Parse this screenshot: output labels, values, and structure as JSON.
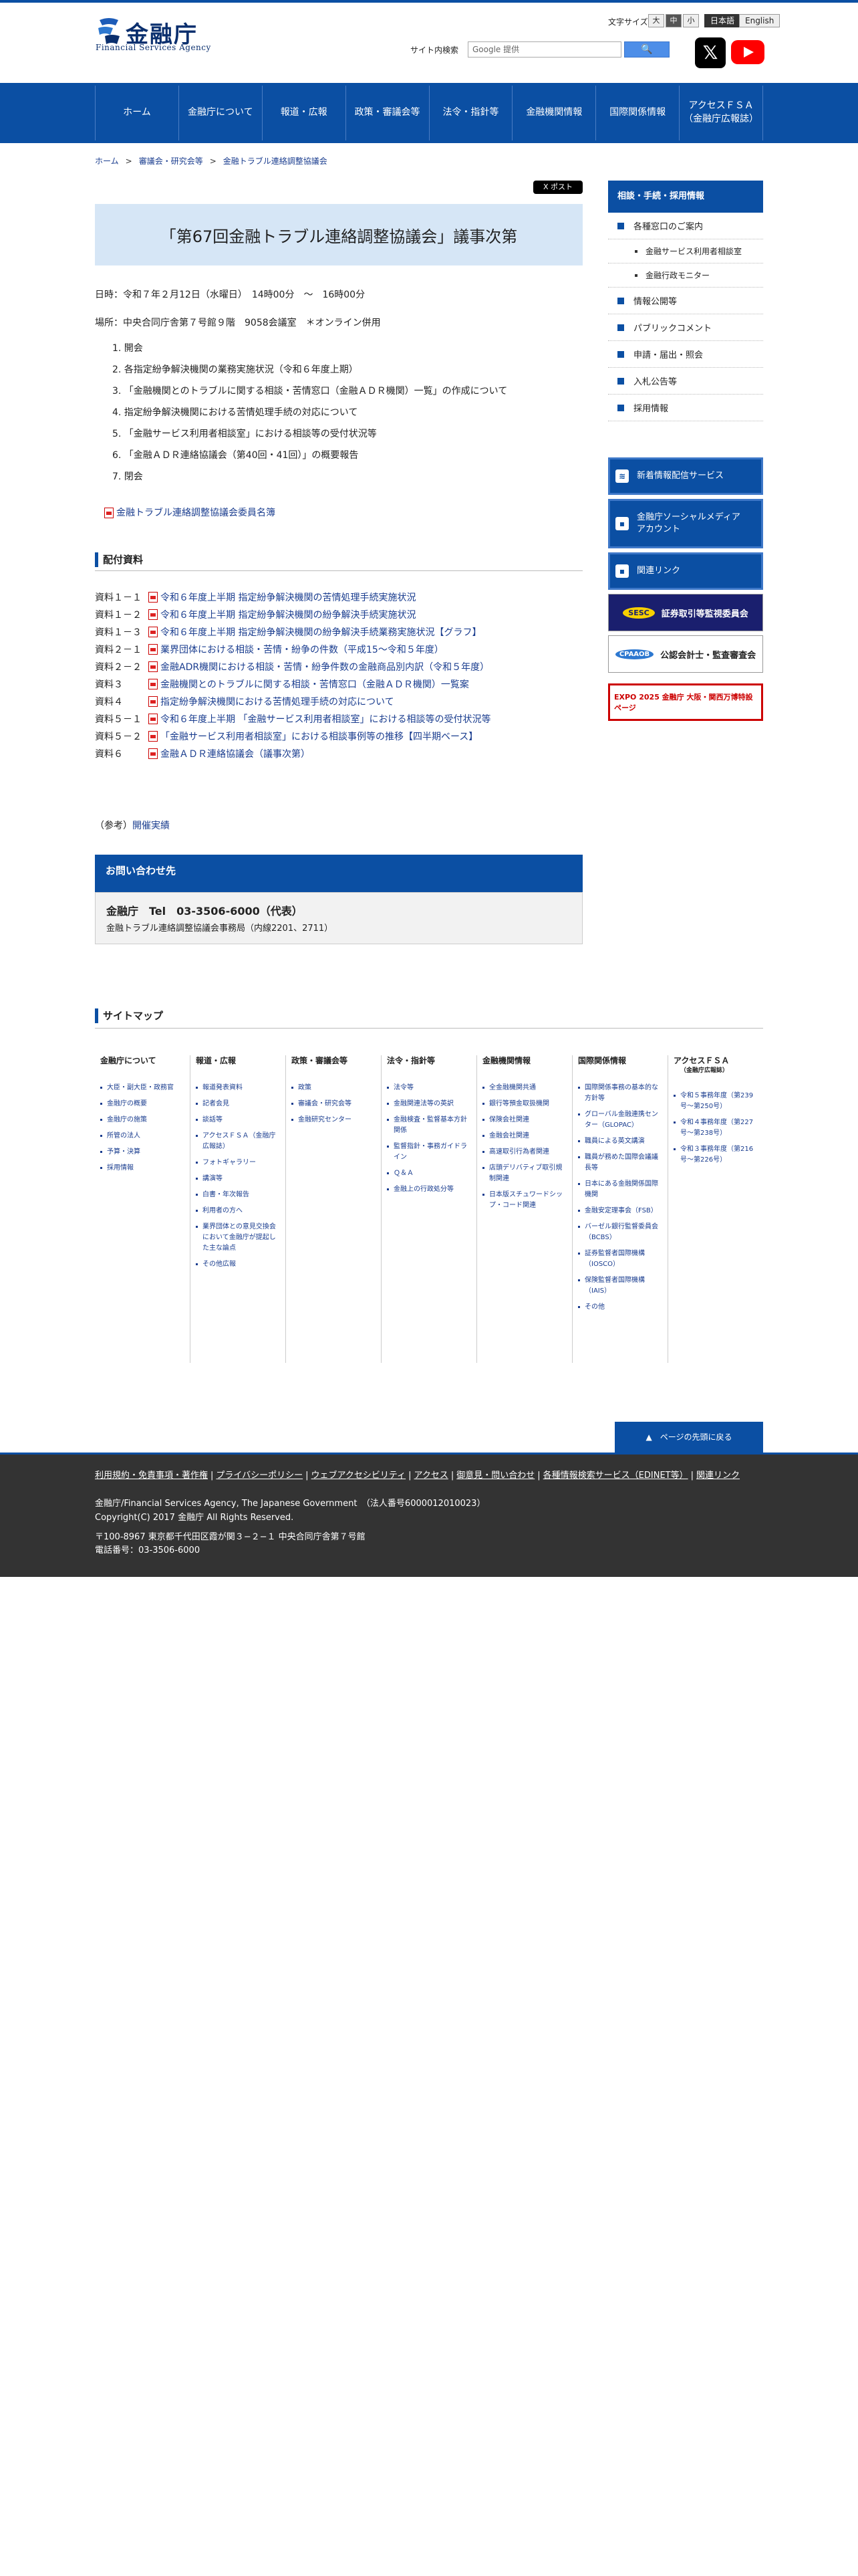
{
  "header": {
    "logo_text": "金融庁",
    "logo_sub": "Financial Services Agency",
    "font_size_label": "文字サイズ",
    "font_sizes": [
      "大",
      "中",
      "小"
    ],
    "lang": [
      "日本語",
      "English"
    ],
    "search_label": "サイト内検索",
    "search_placeholder": "Google 提供",
    "search_button": "🔍",
    "x_icon": "x-icon",
    "youtube_icon": "youtube-icon"
  },
  "nav": [
    "ホーム",
    "金融庁について",
    "報道・広報",
    "政策・審議会等",
    "法令・指針等",
    "金融機関情報",
    "国際関係情報",
    "アクセスＦＳＡ\n（金融庁広報誌）"
  ],
  "breadcrumb": [
    "ホーム",
    "審議会・研究会等",
    "金融トラブル連絡調整協議会"
  ],
  "tweet": "X ポスト",
  "main": {
    "title": "「第67回金融トラブル連絡調整協議会」議事次第",
    "datetime": "日時：令和７年２月12日（水曜日）　14時00分　～　16時00分",
    "place": "場所：中央合同庁舎第７号館９階　9058会議室　＊オンライン併用",
    "agenda": [
      "1. 開会",
      "2. 各指定紛争解決機関の業務実施状況（令和６年度上期）",
      "3. 「金融機関とのトラブルに関する相談・苦情窓口（金融ＡＤＲ機関）一覧」の作成について",
      "4. 指定紛争解決機関における苦情処理手続の対応について",
      "5. 「金融サービス利用者相談室」における相談等の受付状況等",
      "6. 「金融ＡＤＲ連絡協議会（第40回・41回）」の概要報告",
      "7. 閉会"
    ],
    "member_link": "金融トラブル連絡調整協議会委員名簿",
    "materials_heading": "配付資料",
    "materials": [
      {
        "label": "資料１－１",
        "text": "令和６年度上半期 指定紛争解決機関の苦情処理手続実施状況"
      },
      {
        "label": "資料１－２",
        "text": "令和６年度上半期 指定紛争解決機関の紛争解決手続実施状況"
      },
      {
        "label": "資料１－３",
        "text": "令和６年度上半期 指定紛争解決機関の紛争解決手続業務実施状況【グラフ】"
      },
      {
        "label": "資料２－１",
        "text": "業界団体における相談・苦情・紛争の件数（平成15～令和５年度）"
      },
      {
        "label": "資料２－２",
        "text": "金融ADR機関における相談・苦情・紛争件数の金融商品別内訳（令和５年度）"
      },
      {
        "label": "資料３",
        "text": "金融機関とのトラブルに関する相談・苦情窓口（金融ＡＤＲ機関）一覧案"
      },
      {
        "label": "資料４",
        "text": "指定紛争解決機関における苦情処理手続の対応について"
      },
      {
        "label": "資料５－１",
        "text": "令和６年度上半期 「金融サービス利用者相談室」における相談等の受付状況等"
      },
      {
        "label": "資料５－２",
        "text": "「金融サービス利用者相談室」における相談事例等の推移【四半期ベース】"
      },
      {
        "label": "資料６",
        "text": "金融ＡＤＲ連絡協議会（議事次第）"
      }
    ],
    "ref_prefix": "（参考）",
    "ref_link": "開催実績",
    "contact_heading": "お問い合わせ先",
    "contact_tel": "金融庁　Tel　03-3506-6000（代表）",
    "contact_org": "金融トラブル連絡調整協議会事務局（内線2201、2711）"
  },
  "side": {
    "heading": "相談・手続・採用情報",
    "items": [
      {
        "label": "各種窓口のご案内",
        "sub": [
          "金融サービス利用者相談室",
          "金融行政モニター"
        ]
      },
      {
        "label": "情報公開等",
        "sub": []
      },
      {
        "label": "パブリックコメント",
        "sub": []
      },
      {
        "label": "申請・届出・照会",
        "sub": []
      },
      {
        "label": "入札公告等",
        "sub": []
      },
      {
        "label": "採用情報",
        "sub": []
      }
    ],
    "blue_buttons": [
      "新着情報配信サービス",
      "金融庁ソーシャルメディア\nアカウント",
      "関連リンク"
    ],
    "banners": [
      "証券取引等監視委員会",
      "公認会計士・監査審査会",
      "EXPO 2025 金融庁 大阪・関西万博特設ページ"
    ]
  },
  "sitemap": {
    "heading": "サイトマップ",
    "columns": [
      {
        "title": "金融庁について",
        "sub": "",
        "items": [
          "大臣・副大臣・政務官",
          "金融庁の概要",
          "金融庁の施策",
          "所管の法人",
          "予算・決算",
          "採用情報"
        ]
      },
      {
        "title": "報道・広報",
        "sub": "",
        "items": [
          "報道発表資料",
          "記者会見",
          "談話等",
          "アクセスＦＳＡ（金融庁広報誌）",
          "フォトギャラリー",
          "講演等",
          "白書・年次報告",
          "利用者の方へ",
          "業界団体との意見交換会において金融庁が提起した主な論点",
          "その他広報"
        ]
      },
      {
        "title": "政策・審議会等",
        "sub": "",
        "items": [
          "政策",
          "審議会・研究会等",
          "金融研究センター"
        ]
      },
      {
        "title": "法令・指針等",
        "sub": "",
        "items": [
          "法令等",
          "金融関連法等の英訳",
          "金融検査・監督基本方針関係",
          "監督指針・事務ガイドライン",
          "Ｑ＆Ａ",
          "金融上の行政処分等"
        ]
      },
      {
        "title": "金融機関情報",
        "sub": "",
        "items": [
          "全金融機関共通",
          "銀行等預金取扱機関",
          "保険会社関連",
          "金融会社関連",
          "高速取引行為者関連",
          "店頭デリバティブ取引規制関連",
          "日本版スチュワードシップ・コード関連"
        ]
      },
      {
        "title": "国際関係情報",
        "sub": "",
        "items": [
          "国際関係事務の基本的な方針等",
          "グローバル金融連携センター（GLOPAC）",
          "職員による英文講演",
          "職員が務めた国際会議議長等",
          "日本にある金融関係国際機関",
          "金融安定理事会（FSB）",
          "バーゼル銀行監督委員会（BCBS）",
          "証券監督者国際機構（IOSCO）",
          "保険監督者国際機構（IAIS）",
          "その他"
        ]
      },
      {
        "title": "アクセスＦＳＡ",
        "sub": "（金融庁広報誌）",
        "items": [
          "令和５事務年度（第239号〜第250号）",
          "令和４事務年度（第227号〜第238号）",
          "令和３事務年度（第216号〜第226号）"
        ]
      }
    ],
    "to_top": "▲　ページの先頭に戻る"
  },
  "footer": {
    "links": [
      "利用規約・免責事項・著作権",
      "プライバシーポリシー",
      "ウェブアクセシビリティ",
      "アクセス",
      "御意見・問い合わせ",
      "各種情報検索サービス（EDINET等）",
      "関連リンク"
    ],
    "org": "金融庁/Financial Services Agency, The Japanese Government　（法人番号6000012010023）",
    "copyright": "Copyright(C) 2017 金融庁 All Rights Reserved.",
    "address": "〒100-8967 東京都千代田区霞が関３−２−１ 中央合同庁舎第７号館",
    "phone": "電話番号：03-3506-6000"
  }
}
